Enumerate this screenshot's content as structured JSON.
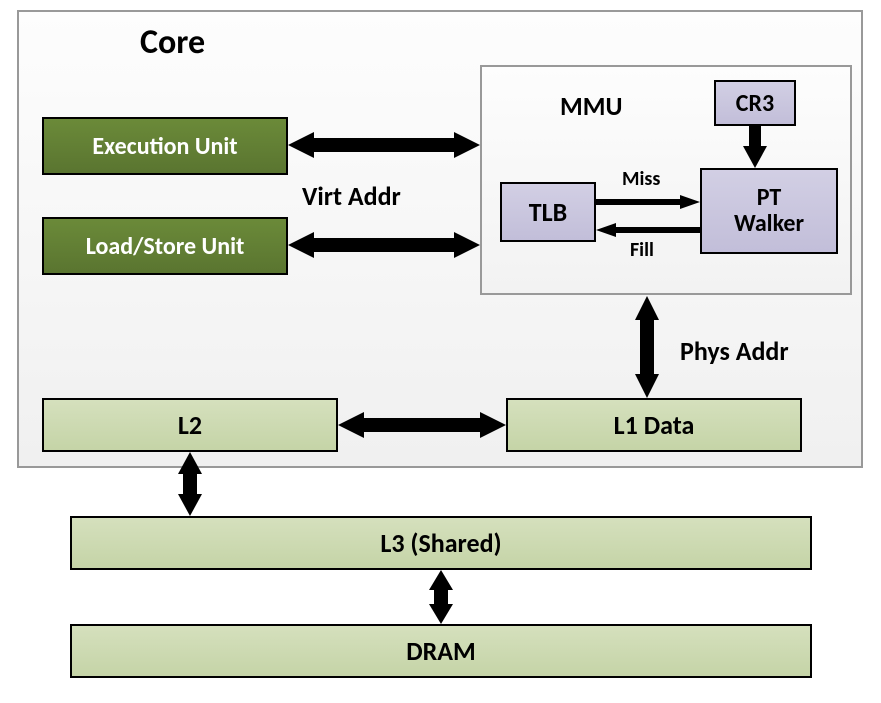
{
  "core": {
    "title": "Core"
  },
  "units": {
    "exec": "Execution Unit",
    "loadstore": "Load/Store Unit"
  },
  "mmu": {
    "title": "MMU",
    "tlb": "TLB",
    "cr3": "CR3",
    "ptwalker": "PT Walker",
    "miss": "Miss",
    "fill": "Fill"
  },
  "caches": {
    "l2": "L2",
    "l1d": "L1 Data",
    "l3": "L3 (Shared)",
    "dram": "DRAM"
  },
  "labels": {
    "virtaddr": "Virt Addr",
    "physaddr": "Phys Addr"
  }
}
